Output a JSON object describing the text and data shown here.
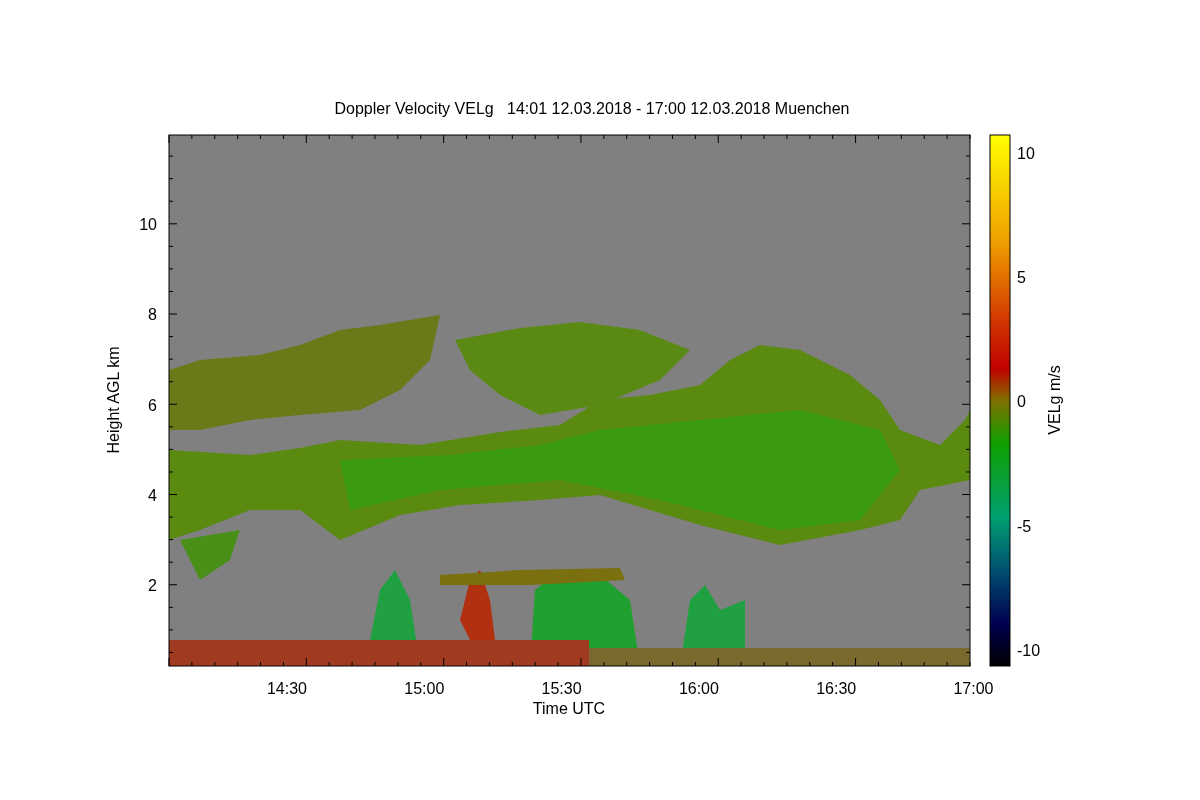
{
  "title": "Doppler Velocity VELg   14:01 12.03.2018 - 17:00 12.03.2018 Muenchen",
  "plot": {
    "ylabel": "Height AGL km",
    "yticks": [
      "10",
      "8",
      "6",
      "4",
      "2"
    ],
    "xlabel": "Time UTC",
    "xticks": [
      "14:30",
      "15:00",
      "15:30",
      "16:00",
      "16:30",
      "17:00"
    ]
  },
  "colorbar": {
    "label": "VELg m/s",
    "ticks": [
      "10",
      "5",
      "0",
      "-5",
      "-10"
    ]
  }
}
